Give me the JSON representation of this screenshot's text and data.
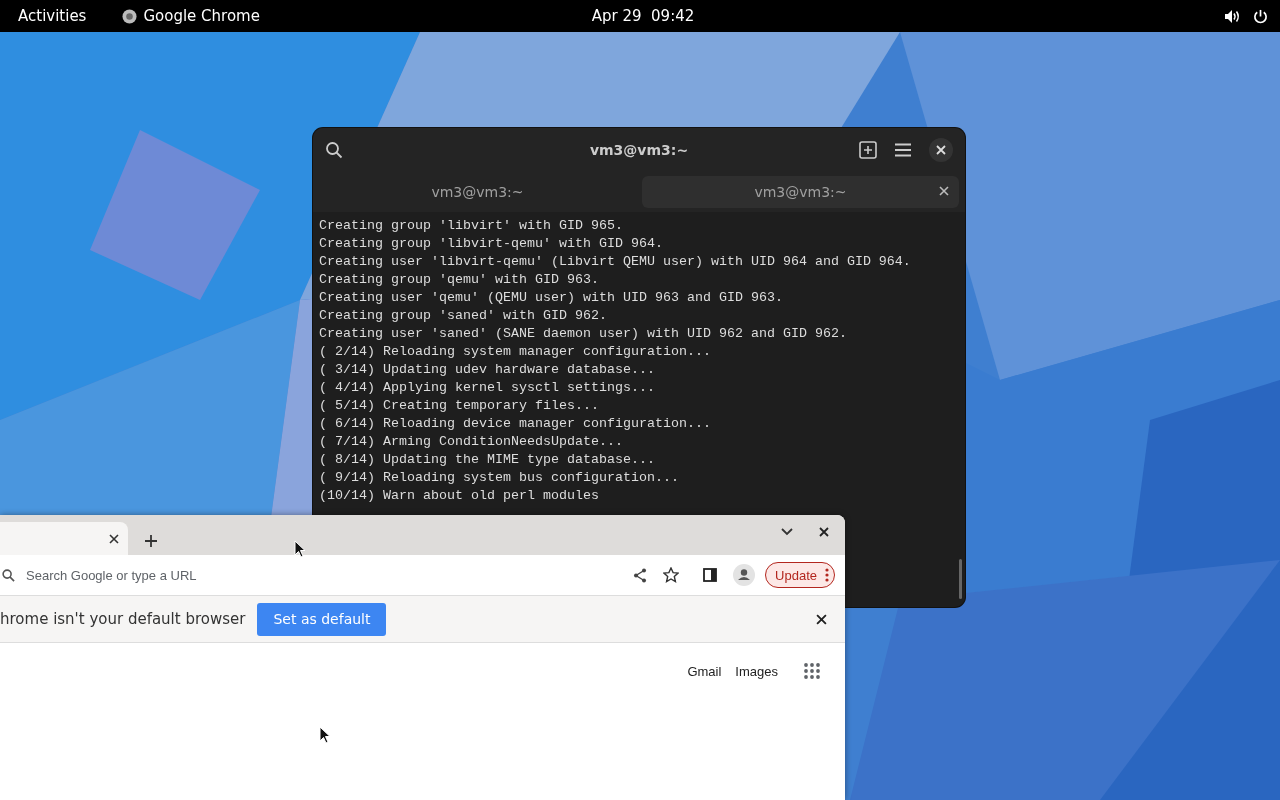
{
  "top_bar": {
    "activities": "Activities",
    "app_name": "Google Chrome",
    "clock": "Apr 29  09:42"
  },
  "terminal": {
    "title": "vm3@vm3:~",
    "tabs": [
      {
        "label": "vm3@vm3:~",
        "selected": false
      },
      {
        "label": "vm3@vm3:~",
        "selected": true
      }
    ],
    "lines": [
      "Creating group 'libvirt' with GID 965.",
      "Creating group 'libvirt-qemu' with GID 964.",
      "Creating user 'libvirt-qemu' (Libvirt QEMU user) with UID 964 and GID 964.",
      "Creating group 'qemu' with GID 963.",
      "Creating user 'qemu' (QEMU user) with UID 963 and GID 963.",
      "Creating group 'saned' with GID 962.",
      "Creating user 'saned' (SANE daemon user) with UID 962 and GID 962.",
      "( 2/14) Reloading system manager configuration...",
      "( 3/14) Updating udev hardware database...",
      "( 4/14) Applying kernel sysctl settings...",
      "( 5/14) Creating temporary files...",
      "( 6/14) Reloading device manager configuration...",
      "( 7/14) Arming ConditionNeedsUpdate...",
      "( 8/14) Updating the MIME type database...",
      "( 9/14) Reloading system bus configuration...",
      "(10/14) Warn about old perl modules"
    ]
  },
  "browser": {
    "tabs": [
      {
        "selected": true
      }
    ],
    "address": {
      "placeholder": "Search Google or type a URL"
    },
    "update_button": "Update",
    "infobar": {
      "message": "hrome isn't your default browser",
      "button": "Set as default"
    },
    "links": [
      "Gmail",
      "Images"
    ]
  }
}
